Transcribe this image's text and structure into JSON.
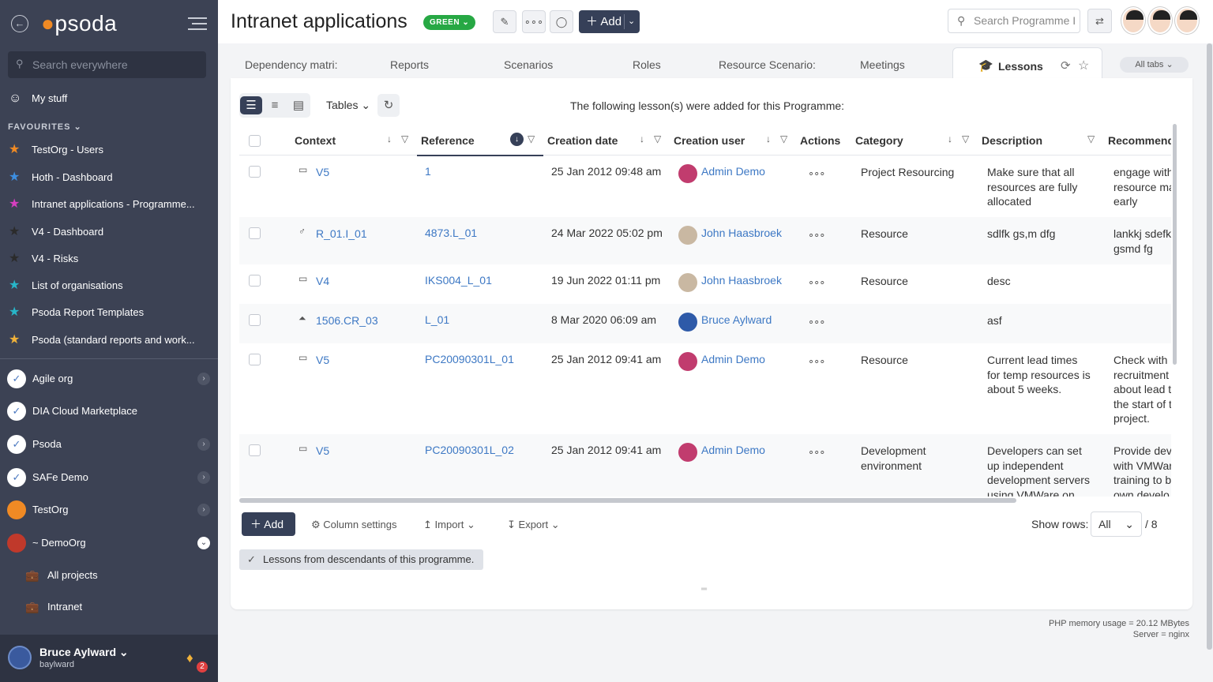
{
  "sidebar": {
    "logo": "psoda",
    "search_placeholder": "Search everywhere",
    "my_stuff": "My stuff",
    "favourites_label": "FAVOURITES",
    "favourites": [
      {
        "label": "TestOrg - Users",
        "color": "#f08a24"
      },
      {
        "label": "Hoth - Dashboard",
        "color": "#3d8ee0"
      },
      {
        "label": "Intranet applications - Programme...",
        "color": "#d63fbf"
      },
      {
        "label": "V4 - Dashboard",
        "color": "#2b2b2b"
      },
      {
        "label": "V4 - Risks",
        "color": "#2b2b2b"
      },
      {
        "label": "List of organisations",
        "color": "#27b6c9"
      },
      {
        "label": "Psoda Report Templates",
        "color": "#27b6c9"
      },
      {
        "label": "Psoda (standard reports and work...",
        "color": "#f0b23a"
      }
    ],
    "orgs": [
      {
        "label": "Agile org",
        "expandable": true
      },
      {
        "label": "DIA Cloud Marketplace",
        "expandable": false
      },
      {
        "label": "Psoda",
        "expandable": true
      },
      {
        "label": "SAFe Demo",
        "expandable": true
      },
      {
        "label": "TestOrg",
        "expandable": true
      },
      {
        "label": "~ DemoOrg",
        "expandable": true
      }
    ],
    "sub_items": [
      "All projects",
      "Intranet"
    ],
    "user": {
      "name": "Bruce Aylward",
      "login": "baylward",
      "notifications": "2"
    }
  },
  "header": {
    "title": "Intranet applications",
    "status": "GREEN",
    "add_label": "Add",
    "search_placeholder": "Search Programme I"
  },
  "tabs": {
    "items": [
      "Dependency matri:",
      "Reports",
      "Scenarios",
      "Roles",
      "Resource Scenario:",
      "Meetings"
    ],
    "active": "Lessons",
    "all_tabs": "All tabs"
  },
  "toolbar": {
    "tables_label": "Tables",
    "notice": "The following lesson(s) were added for this Programme:"
  },
  "table": {
    "columns": [
      "Context",
      "Reference",
      "Creation date",
      "Creation user",
      "Actions",
      "Category",
      "Description",
      "Recommend"
    ],
    "rows": [
      {
        "ctx_icon": "▭",
        "context": "V5",
        "reference": "1",
        "date": "25 Jan 2012 09:48 am",
        "user": "Admin Demo",
        "user_av": "ad",
        "category": "Project Resourcing",
        "desc": [
          "Make sure that all",
          "resources are fully",
          "allocated"
        ],
        "rec": [
          "engage with",
          "resource ma",
          "early"
        ]
      },
      {
        "ctx_icon": "♂",
        "context": "R_01.I_01",
        "reference": "4873.L_01",
        "date": "24 Mar 2022 05:02 pm",
        "user": "John Haasbroek",
        "user_av": "jh",
        "category": "Resource",
        "desc": [
          "sdlfk gs,m dfg"
        ],
        "rec": [
          "lankkj sdefk",
          "gsmd fg"
        ]
      },
      {
        "ctx_icon": "▭",
        "context": "V4",
        "reference": "IKS004_L_01",
        "date": "19 Jun 2022 01:11 pm",
        "user": "John Haasbroek",
        "user_av": "jh",
        "category": "Resource",
        "desc": [
          "desc"
        ],
        "rec": []
      },
      {
        "ctx_icon": "⏶",
        "context": "1506.CR_03",
        "reference": "L_01",
        "date": "8 Mar 2020 06:09 am",
        "user": "Bruce Aylward",
        "user_av": "ba",
        "category": "",
        "desc": [
          "asf"
        ],
        "rec": []
      },
      {
        "ctx_icon": "▭",
        "context": "V5",
        "reference": "PC20090301L_01",
        "date": "25 Jan 2012 09:41 am",
        "user": "Admin Demo",
        "user_av": "ad",
        "category": "Resource",
        "desc": [
          "Current lead times",
          "for temp resources is",
          "about 5 weeks."
        ],
        "rec": [
          "Check with",
          "recruitment",
          "about lead t",
          "the start of t",
          "project."
        ]
      },
      {
        "ctx_icon": "▭",
        "context": "V5",
        "reference": "PC20090301L_02",
        "date": "25 Jan 2012 09:41 am",
        "user": "Admin Demo",
        "user_av": "ad",
        "category": "Development environment",
        "desc": [
          "Developers can set",
          "up independent",
          "development servers",
          "using VMWare on"
        ],
        "rec": [
          "Provide dev",
          "with VMWar",
          "training to b",
          "own develo"
        ]
      }
    ]
  },
  "footer": {
    "add_label": "Add",
    "column_settings": "Column settings",
    "import": "Import",
    "export": "Export",
    "show_rows_label": "Show rows:",
    "show_rows_value": "All",
    "total": "/ 8",
    "descendants": "Lessons from descendants of this programme."
  },
  "memory": {
    "line1": "PHP memory usage = 20.12 MBytes",
    "line2": "Server = nginx"
  }
}
